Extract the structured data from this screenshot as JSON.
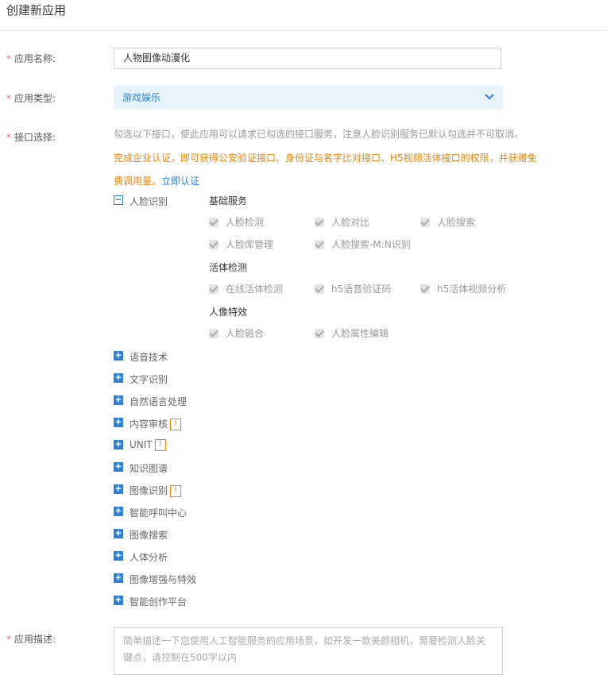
{
  "page": {
    "title": "创建新应用"
  },
  "labels": {
    "app_name": "应用名称:",
    "app_type": "应用类型:",
    "api_select": "接口选择:",
    "app_desc": "应用描述:",
    "required_mark": "*"
  },
  "app_name_value": "人物图像动漫化",
  "app_type_value": "游戏娱乐",
  "hint": "勾选以下接口，使此应用可以请求已勾选的接口服务，注意人脸识别服务已默认勾选并不可取消。",
  "promo": {
    "text": "完成企业认证，即可获得公安验证接口、身份证与名字比对接口、H5视频活体接口的权限，并获赠免费调用量。",
    "link": "立即认证"
  },
  "face": {
    "toggle": "−",
    "label": "人脸识别",
    "groups": [
      {
        "title": "基础服务",
        "items": [
          "人脸检测",
          "人脸对比",
          "人脸搜索",
          "人脸库管理",
          "人脸搜索-M:N识别"
        ]
      },
      {
        "title": "活体检测",
        "items": [
          "在线活体检测",
          "h5语音验证码",
          "h5活体视频分析"
        ]
      },
      {
        "title": "人像特效",
        "items": [
          "人脸融合",
          "人脸属性编辑"
        ]
      }
    ]
  },
  "services": {
    "toggle": "+",
    "warn_mark": "!",
    "items": [
      "语音技术",
      "文字识别",
      "自然语言处理",
      "内容审核",
      "UNIT",
      "知识图谱",
      "图像识别",
      "智能呼叫中心",
      "图像搜索",
      "人体分析",
      "图像增强与特效",
      "智能创作平台"
    ]
  },
  "desc_placeholder": "简单描述一下您使用人工智能服务的应用场景，如开发一款美颜相机，需要检测人脸关键点，请控制在500字以内",
  "colors": {
    "accent": "#2f7fd3",
    "warning": "#e8850a",
    "required": "#f56c6c",
    "select_bg": "#e8f4fd"
  }
}
